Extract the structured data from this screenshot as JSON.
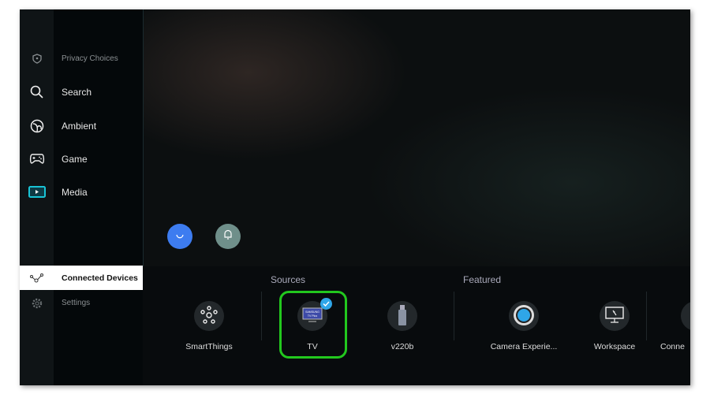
{
  "sidebar": {
    "items": [
      {
        "label": "Privacy Choices",
        "icon": "shield-icon"
      },
      {
        "label": "Search",
        "icon": "search-icon"
      },
      {
        "label": "Ambient",
        "icon": "ambient-icon"
      },
      {
        "label": "Game",
        "icon": "gamepad-icon"
      },
      {
        "label": "Media",
        "icon": "media-play-icon"
      },
      {
        "label": "Connected Devices",
        "icon": "connected-devices-icon",
        "selected": true
      },
      {
        "label": "Settings",
        "icon": "gear-icon"
      }
    ]
  },
  "bubbles": [
    {
      "icon": "smiley-icon",
      "color": "#3d7cf0"
    },
    {
      "icon": "bell-icon",
      "color": "#6f8f8a"
    }
  ],
  "sections": {
    "sources": "Sources",
    "featured": "Featured"
  },
  "tiles": [
    {
      "label": "SmartThings",
      "icon": "smartthings-icon"
    },
    {
      "label": "TV",
      "icon": "tv-icon",
      "selected": true,
      "logo": "SAMSUNG TV Plus"
    },
    {
      "label": "v220b",
      "icon": "usb-drive-icon"
    },
    {
      "label": "Camera Experie...",
      "icon": "camera-icon"
    },
    {
      "label": "Workspace",
      "icon": "workspace-icon"
    },
    {
      "label": "Conne",
      "icon": "connect-icon"
    }
  ],
  "colors": {
    "focus": "#22c81e",
    "check": "#2fa6e8",
    "media": "#19c4d6"
  }
}
